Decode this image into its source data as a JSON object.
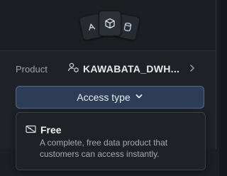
{
  "header": {
    "icons": [
      "snowflake-app-icon",
      "cube-icon",
      "database-icon"
    ]
  },
  "product_row": {
    "label": "Product",
    "value": "KAWABATA_DWH...",
    "icon": "product-share-icon"
  },
  "access_button": {
    "label": "Access type",
    "icon": "chevron-down-icon"
  },
  "dropdown": {
    "options": [
      {
        "title": "Free",
        "description": "A complete, free data product that customers can access instantly.",
        "icon": "free-tag-icon"
      }
    ]
  },
  "colors": {
    "background": "#1b1f24",
    "button_bg": "#2c3d55",
    "button_border": "#4d6a90",
    "text_primary": "#e6e9ec",
    "text_secondary": "#a4abb3"
  }
}
